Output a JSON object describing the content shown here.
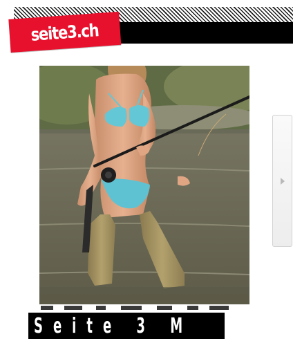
{
  "header": {
    "logo_text": "seite3.ch"
  },
  "gallery": {
    "next_icon": "chevron-right-icon",
    "caption": "Seite 3 M"
  },
  "colors": {
    "brand_red": "#e8112d",
    "bar_black": "#000000"
  }
}
